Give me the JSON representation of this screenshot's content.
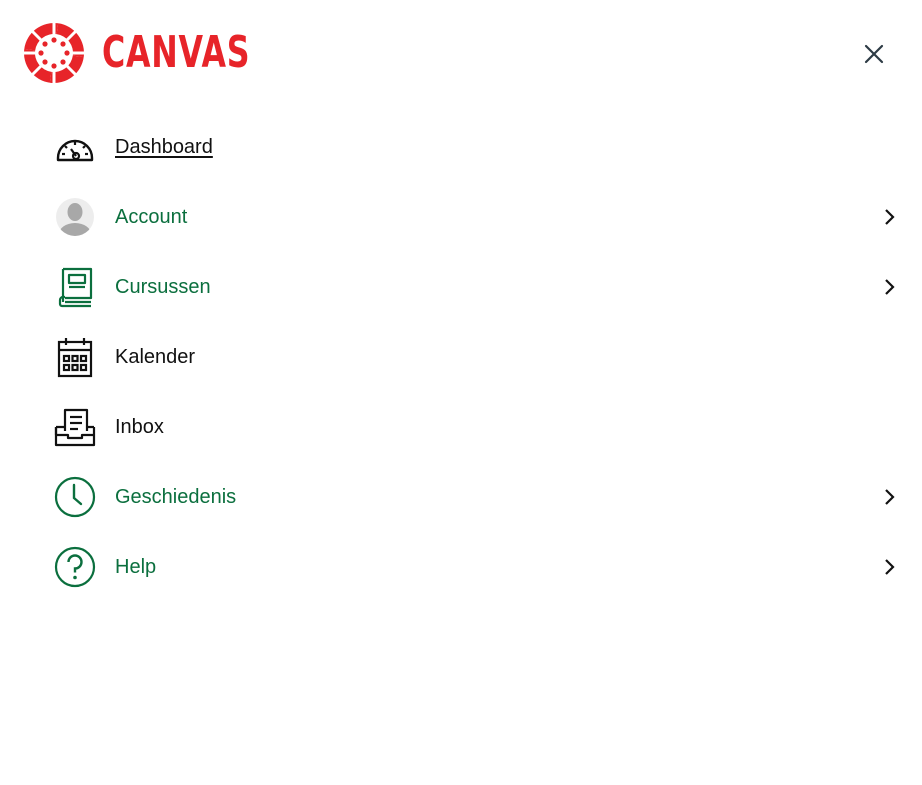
{
  "brand": {
    "name": "CANVAS",
    "color": "#E72429"
  },
  "colors": {
    "link_green": "#0B6F3E",
    "text_black": "#111111"
  },
  "header": {
    "close_icon": "close-icon"
  },
  "menu": {
    "items": [
      {
        "label": "Dashboard",
        "icon": "dashboard-icon",
        "color": "#111111",
        "underlined": true,
        "has_chevron": false
      },
      {
        "label": "Account",
        "icon": "avatar-icon",
        "color": "#0B6F3E",
        "underlined": false,
        "has_chevron": true
      },
      {
        "label": "Cursussen",
        "icon": "courses-icon",
        "color": "#0B6F3E",
        "underlined": false,
        "has_chevron": true
      },
      {
        "label": "Kalender",
        "icon": "calendar-icon",
        "color": "#111111",
        "underlined": false,
        "has_chevron": false
      },
      {
        "label": "Inbox",
        "icon": "inbox-icon",
        "color": "#111111",
        "underlined": false,
        "has_chevron": false
      },
      {
        "label": "Geschiedenis",
        "icon": "clock-icon",
        "color": "#0B6F3E",
        "underlined": false,
        "has_chevron": true
      },
      {
        "label": "Help",
        "icon": "help-icon",
        "color": "#0B6F3E",
        "underlined": false,
        "has_chevron": true
      }
    ]
  }
}
